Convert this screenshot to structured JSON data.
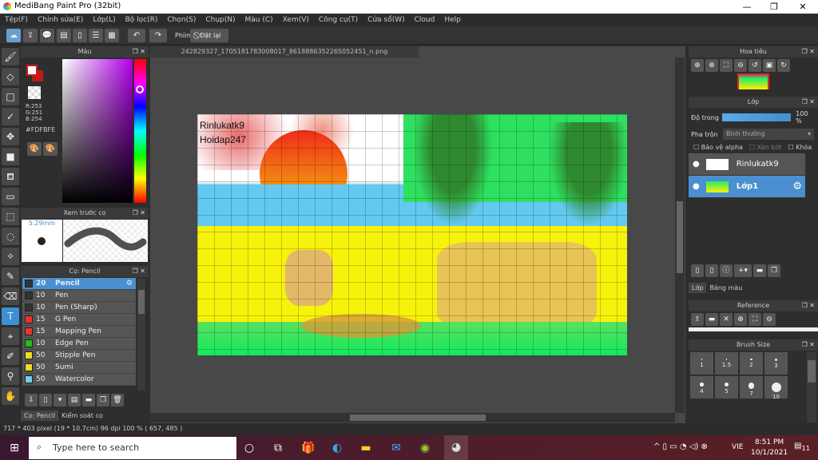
{
  "app": {
    "title": "MediBang Paint Pro (32bit)"
  },
  "menu": [
    "Tệp(F)",
    "Chỉnh sửa(E)",
    "Lớp(L)",
    "Bộ lọc(R)",
    "Chọn(S)",
    "Chụp(N)",
    "Màu (C)",
    "Xem(V)",
    "Công cụ(T)",
    "Cửa sổ(W)",
    "Cloud",
    "Help"
  ],
  "toolbar": {
    "keys_label": "Phím",
    "reset_label": "Đặt lại"
  },
  "color": {
    "title": "Màu",
    "r": "R:253",
    "g": "G:251",
    "b": "B:254",
    "hex": "#FDFBFE",
    "main": "#FDFBFE",
    "sub": "#c01818"
  },
  "preview": {
    "title": "Xem trước cọ",
    "size": "5.29mm"
  },
  "brushes": {
    "title": "Cọ: Pencil",
    "items": [
      {
        "size": "20",
        "name": "Pencil",
        "color": "#333333"
      },
      {
        "size": "10",
        "name": "Pen",
        "color": "#333333"
      },
      {
        "size": "10",
        "name": "Pen (Sharp)",
        "color": "#333333"
      },
      {
        "size": "15",
        "name": "G Pen",
        "color": "#ee3333"
      },
      {
        "size": "15",
        "name": "Mapping Pen",
        "color": "#ee3333"
      },
      {
        "size": "10",
        "name": "Edge Pen",
        "color": "#22bb22"
      },
      {
        "size": "50",
        "name": "Stipple Pen",
        "color": "#eedd22"
      },
      {
        "size": "50",
        "name": "Sumi",
        "color": "#eedd22"
      },
      {
        "size": "50",
        "name": "Watercolor",
        "color": "#77ccee"
      }
    ],
    "tabs": [
      "Cọ: Pencil",
      "Kiểm soát cọ"
    ]
  },
  "document": {
    "tab": "242829327_1705181783008017_8618886352265052451_n.png",
    "text1": "Rinlukatk9",
    "text2": "Hoidap247"
  },
  "navigator": {
    "title": "Hoa tiêu"
  },
  "layers": {
    "title": "Lớp",
    "opacity_label": "Độ trong",
    "opacity_value": "100 %",
    "opacity": 1.0,
    "blend_label": "Pha trộn",
    "blend_value": "Bình thường",
    "protect_alpha": "Bảo vệ alpha",
    "clip": "Xén bớt",
    "lock": "Khóa",
    "items": [
      {
        "name": "Rinlukatk9"
      },
      {
        "name": "Lớp1"
      }
    ],
    "tabs": [
      "Lớp",
      "Bảng màu"
    ]
  },
  "reference": {
    "title": "Reference"
  },
  "brush_size": {
    "title": "Brush Size",
    "sizes": [
      "1",
      "1.5",
      "2",
      "3",
      "4",
      "5",
      "7",
      "10"
    ]
  },
  "status": {
    "text": "717 * 403 pixel   (19 * 10.7cm)   96 dpi   100 %   ( 657, 485 )"
  },
  "taskbar": {
    "search_placeholder": "Type here to search",
    "time": "8:51 PM",
    "date": "10/1/2021",
    "lang": "VIE",
    "notifications": "11"
  }
}
